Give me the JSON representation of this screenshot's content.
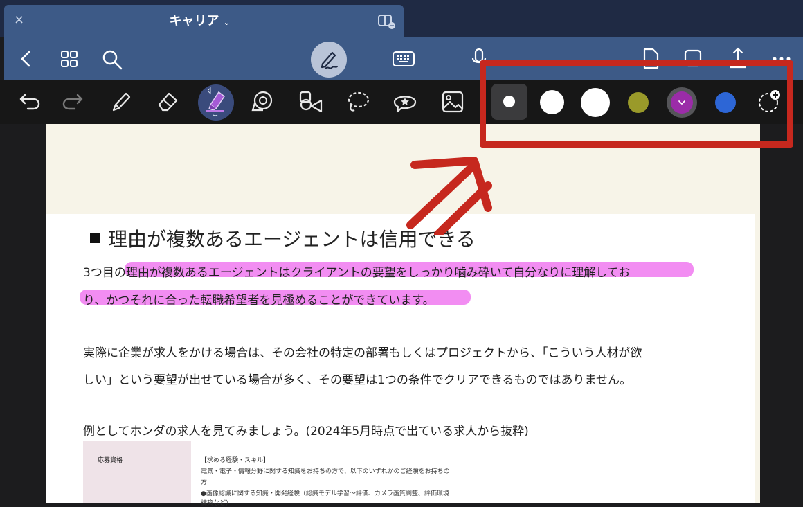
{
  "window": {
    "tab_title": "キャリア",
    "tab_chevron": "⌄",
    "close_glyph": "×"
  },
  "toolbar": {
    "tools": [
      "undo",
      "redo",
      "pen",
      "eraser",
      "highlighter",
      "tape",
      "shapes",
      "lasso",
      "sticker",
      "image"
    ],
    "active_tool": "highlighter"
  },
  "colors": {
    "accent": "#3d5a87",
    "swatch_olive": "#9a9a2a",
    "swatch_purple": "#9b2ca8",
    "swatch_blue": "#2d66d6",
    "highlight": "#f28df2",
    "annotation_red": "#c6281e"
  },
  "document": {
    "heading": "理由が複数あるエージェントは信用できる",
    "para1_line1": "3つ目の理由が複数あるエージェントはクライアントの要望をしっかり噛み砕いて自分なりに理解してお",
    "para1_line2": "り、かつそれに合った転職希望者を見極めることができています。",
    "para2_line1": "実際に企業が求人をかける場合は、その会社の特定の部署もしくはプロジェクトから、「こういう人材が欲",
    "para2_line2": "しい」という要望が出せている場合が多く、その要望は1つの条件でクリアできるものではありません。",
    "para3_line1": "例としてホンダの求人を見てみましょう。(2024年5月時点で出ている求人から抜粋)",
    "image": {
      "label": "応募資格",
      "line1": "【求める経験・スキル】",
      "line2": "電気・電子・情報分野に関する知識をお持ちの方で、以下のいずれかのご経験をお持ちの",
      "line3": "方",
      "line4": "●画像認識に関する知識・開発経験（認識モデル学習〜評価、カメラ画質調整、評価環境",
      "line5": "構築など）"
    }
  }
}
